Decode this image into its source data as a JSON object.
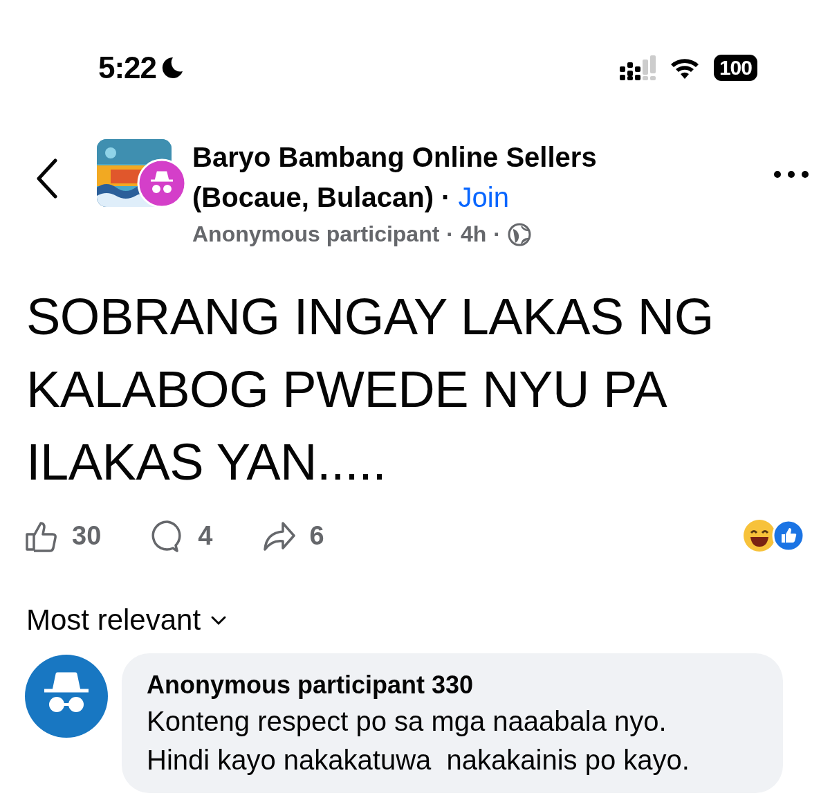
{
  "status_bar": {
    "time": "5:22",
    "battery": "100"
  },
  "header": {
    "group_name": "Baryo Bambang Online Sellers (Bocaue, Bulacan)",
    "separator": "·",
    "join": "Join",
    "author": "Anonymous participant",
    "age": "4h"
  },
  "post": {
    "text": "SOBRANG INGAY LAKAS NG KALABOG PWEDE NYU PA ILAKAS YAN....."
  },
  "actions": [
    {
      "kind": "like",
      "count": "30"
    },
    {
      "kind": "comment",
      "count": "4"
    },
    {
      "kind": "share",
      "count": "6"
    }
  ],
  "sort": {
    "label": "Most relevant"
  },
  "comments": [
    {
      "author": "Anonymous participant 330",
      "text": "Konteng respect po sa mga naaabala nyo.\nHindi kayo nakakatuwa  nakakainis po kayo."
    }
  ]
}
